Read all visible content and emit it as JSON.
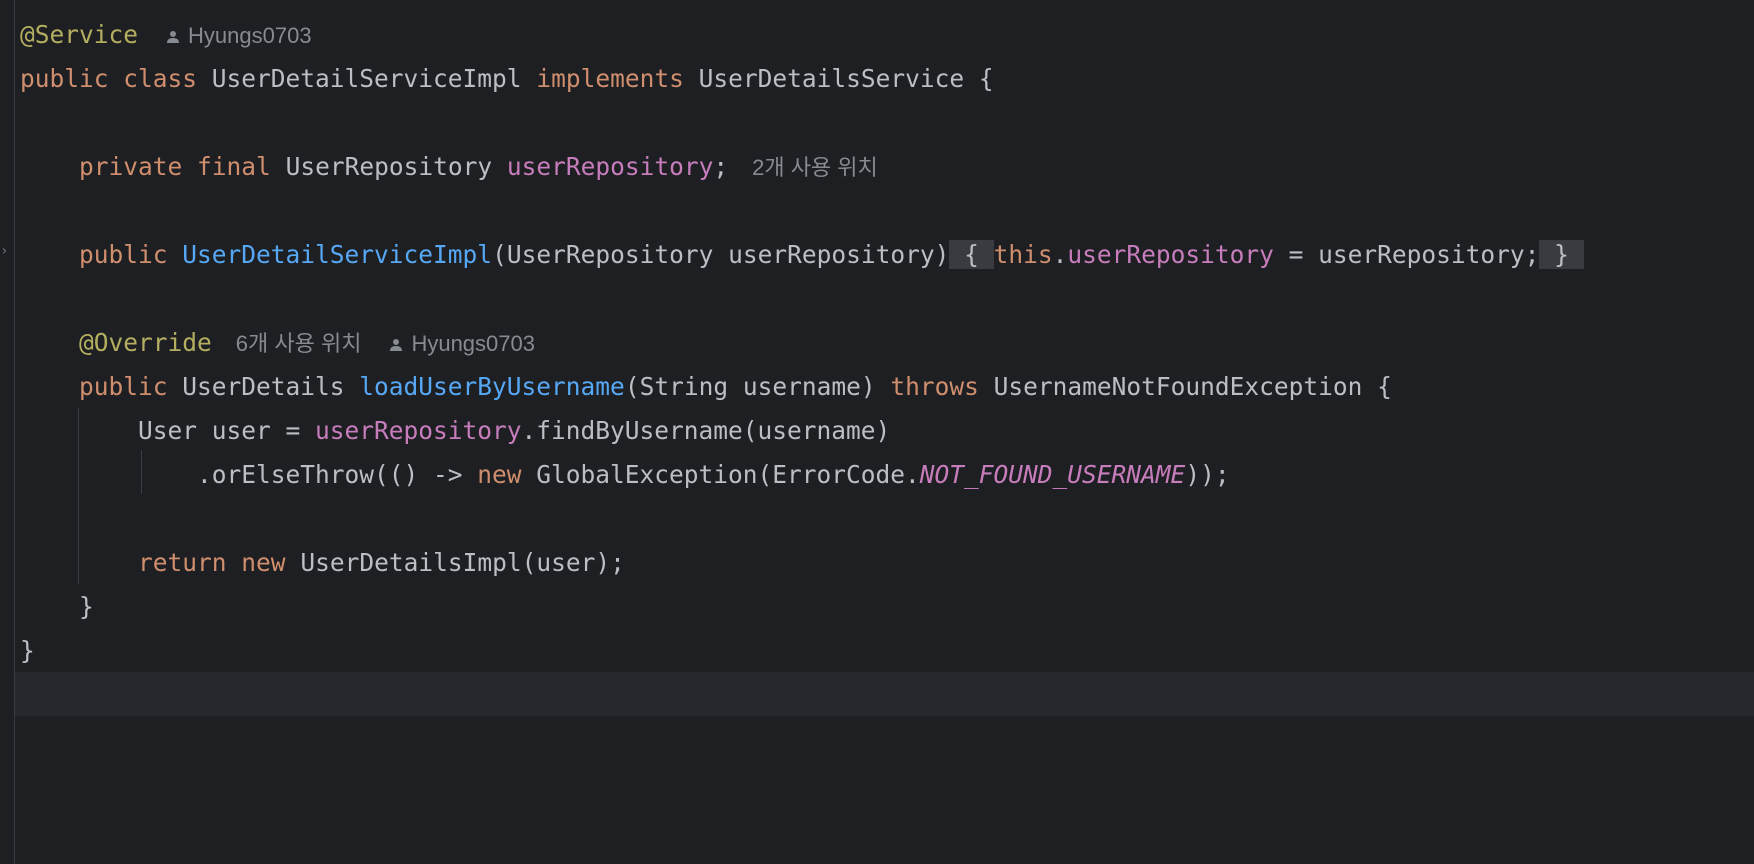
{
  "editor": {
    "lines": [
      {
        "id": "line-1",
        "tokens": [
          {
            "t": "@Service",
            "c": "ann",
            "name": "annotation-service"
          }
        ],
        "author_hint": "Hyungs0703"
      },
      {
        "id": "line-2",
        "tokens": [
          {
            "t": "public",
            "c": "kw"
          },
          {
            "t": " ",
            "c": "plain"
          },
          {
            "t": "class",
            "c": "kw"
          },
          {
            "t": " UserDetailServiceImpl ",
            "c": "plain"
          },
          {
            "t": "implements",
            "c": "kw"
          },
          {
            "t": " UserDetailsService {",
            "c": "plain"
          }
        ]
      },
      {
        "id": "line-4",
        "tokens": [
          {
            "t": "    ",
            "c": "plain"
          },
          {
            "t": "private",
            "c": "kw"
          },
          {
            "t": " ",
            "c": "plain"
          },
          {
            "t": "final",
            "c": "kw"
          },
          {
            "t": " UserRepository ",
            "c": "plain"
          },
          {
            "t": "userRepository",
            "c": "field"
          },
          {
            "t": ";",
            "c": "plain"
          }
        ],
        "usage_hint": "2개 사용 위치"
      },
      {
        "id": "line-6",
        "tokens": [
          {
            "t": "    ",
            "c": "plain"
          },
          {
            "t": "public",
            "c": "kw"
          },
          {
            "t": " ",
            "c": "plain"
          },
          {
            "t": "UserDetailServiceImpl",
            "c": "fn"
          },
          {
            "t": "(UserRepository userRepository)",
            "c": "plain"
          },
          {
            "t": " { ",
            "c": "plain fold-bg"
          },
          {
            "t": "this",
            "c": "kw"
          },
          {
            "t": ".",
            "c": "plain"
          },
          {
            "t": "userRepository",
            "c": "field"
          },
          {
            "t": " = userRepository;",
            "c": "plain"
          },
          {
            "t": " } ",
            "c": "plain fold-bg"
          }
        ]
      },
      {
        "id": "line-8",
        "tokens": [
          {
            "t": "    ",
            "c": "plain"
          },
          {
            "t": "@Override",
            "c": "ann"
          }
        ],
        "usage_hint": "6개 사용 위치",
        "author_hint": "Hyungs0703"
      },
      {
        "id": "line-9",
        "tokens": [
          {
            "t": "    ",
            "c": "plain"
          },
          {
            "t": "public",
            "c": "kw"
          },
          {
            "t": " UserDetails ",
            "c": "plain"
          },
          {
            "t": "loadUserByUsername",
            "c": "fn"
          },
          {
            "t": "(String username) ",
            "c": "plain"
          },
          {
            "t": "throws",
            "c": "kw"
          },
          {
            "t": " UsernameNotFoundException {",
            "c": "plain"
          }
        ]
      },
      {
        "id": "line-10",
        "tokens": [
          {
            "t": "        User user = ",
            "c": "plain"
          },
          {
            "t": "userRepository",
            "c": "field"
          },
          {
            "t": ".findByUsername(username)",
            "c": "plain"
          }
        ]
      },
      {
        "id": "line-11",
        "tokens": [
          {
            "t": "            .orElseThrow(() -> ",
            "c": "plain"
          },
          {
            "t": "new",
            "c": "kw"
          },
          {
            "t": " GlobalException(ErrorCode.",
            "c": "plain"
          },
          {
            "t": "NOT_FOUND_USERNAME",
            "c": "const"
          },
          {
            "t": "));",
            "c": "plain"
          }
        ]
      },
      {
        "id": "line-13",
        "tokens": [
          {
            "t": "        ",
            "c": "plain"
          },
          {
            "t": "return",
            "c": "kw"
          },
          {
            "t": " ",
            "c": "plain"
          },
          {
            "t": "new",
            "c": "kw"
          },
          {
            "t": " UserDetailsImpl(user);",
            "c": "plain"
          }
        ]
      },
      {
        "id": "line-14",
        "tokens": [
          {
            "t": "    }",
            "c": "plain"
          }
        ]
      },
      {
        "id": "line-15",
        "tokens": [
          {
            "t": "}",
            "c": "plain"
          }
        ]
      }
    ]
  }
}
